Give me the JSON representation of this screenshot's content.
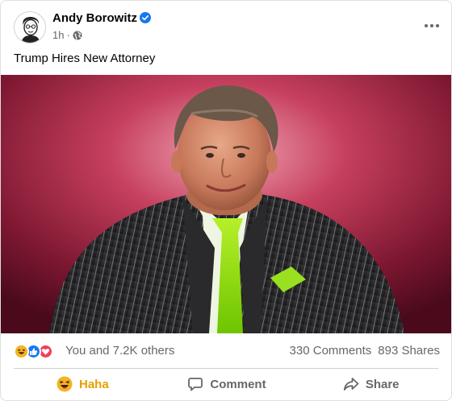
{
  "post": {
    "author": "Andy Borowitz",
    "timestamp": "1h",
    "privacy_separator": "·",
    "text": "Trump Hires New Attorney"
  },
  "reactions": {
    "types": [
      "haha",
      "like",
      "love"
    ],
    "summary": "You and 7.2K others",
    "comments": "330 Comments",
    "shares": "893 Shares"
  },
  "actions": {
    "haha_label": "Haha",
    "comment_label": "Comment",
    "share_label": "Share"
  },
  "colors": {
    "verified": "#1877f2",
    "haha": "#e4a000",
    "like": "#1877f2",
    "love": "#f33e58",
    "muted_text": "#65676b"
  },
  "icons": {
    "verified": "verified-badge-icon",
    "privacy": "globe-icon",
    "more": "more-options-icon",
    "comment": "comment-icon",
    "share": "share-icon"
  }
}
